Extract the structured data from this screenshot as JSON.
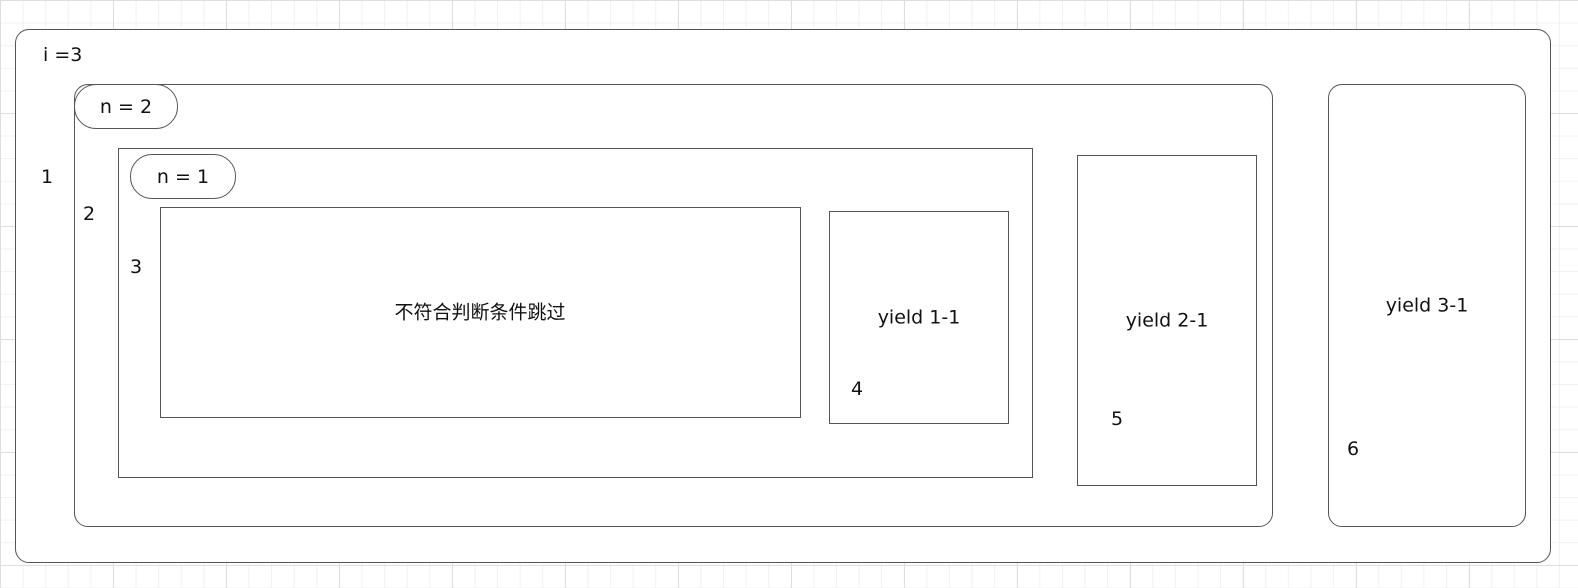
{
  "outer": {
    "title": "i =3",
    "step": "1"
  },
  "scope_n2": {
    "title": "n = 2",
    "step": "2"
  },
  "scope_n1": {
    "title": "n = 1",
    "step": "3"
  },
  "skip_block": {
    "text": "不符合判断条件跳过"
  },
  "yield_1_1": {
    "text": "yield 1-1",
    "step": "4"
  },
  "yield_2_1": {
    "text": "yield 2-1",
    "step": "5"
  },
  "yield_3_1": {
    "text": "yield 3-1",
    "step": "6"
  }
}
